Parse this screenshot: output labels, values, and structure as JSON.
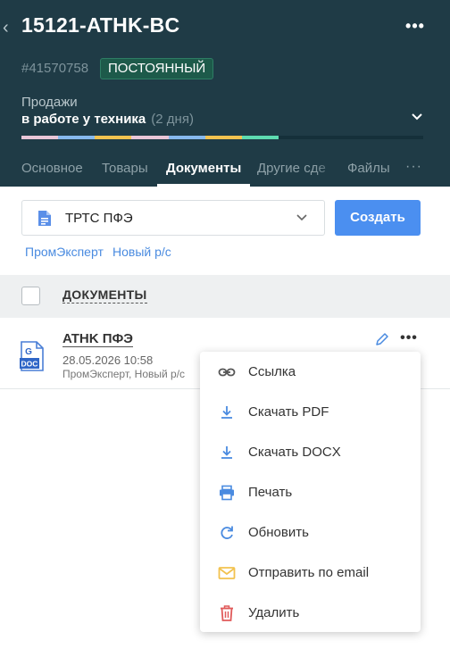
{
  "header": {
    "back_icon": "chevron-left-icon",
    "title": "15121-ATHK-BC",
    "more_icon": "more-horizontal-icon",
    "id": "#41570758",
    "badge": "ПОСТОЯННЫЙ",
    "pipeline": "Продажи",
    "stage": "в работе у техника",
    "stage_duration": "(2 дня)",
    "progress_colors": [
      "#e8c6d8",
      "#86b9ee",
      "#f2c24f",
      "#e8c6d8",
      "#86b9ee",
      "#f2c24f",
      "#5ddbb0"
    ],
    "progress_fraction": 0.64
  },
  "tabs": [
    {
      "label": "Основное"
    },
    {
      "label": "Товары"
    },
    {
      "label": "Документы"
    },
    {
      "label": "Другие сде"
    },
    {
      "label": "Файлы"
    }
  ],
  "tabs_more": "···",
  "documents": {
    "template_select": "ТРТС ПФЭ",
    "create_label": "Создать",
    "filters": [
      "ПромЭксперт",
      "Новый р/с"
    ],
    "list_header": "ДОКУМЕНТЫ",
    "rows": [
      {
        "title": "ATHK ПФЭ",
        "date": "28.05.2026 10:58",
        "org": "ПромЭксперт, Новый р/с",
        "icon_label": "DOC",
        "icon_letter": "G"
      }
    ]
  },
  "menu": {
    "items": [
      {
        "label": "Ссылка",
        "icon": "link-icon"
      },
      {
        "label": "Скачать PDF",
        "icon": "download-icon"
      },
      {
        "label": "Скачать DOCX",
        "icon": "download-icon"
      },
      {
        "label": "Печать",
        "icon": "printer-icon"
      },
      {
        "label": "Обновить",
        "icon": "refresh-icon"
      },
      {
        "label": "Отправить по email",
        "icon": "mail-icon"
      },
      {
        "label": "Удалить",
        "icon": "trash-icon"
      }
    ]
  },
  "colors": {
    "header_bg": "#1f3b46",
    "accent": "#4b8ff0",
    "badge_bg": "#1d5a4a",
    "mail_icon": "#f2c24f",
    "delete_icon": "#e05a5a"
  }
}
